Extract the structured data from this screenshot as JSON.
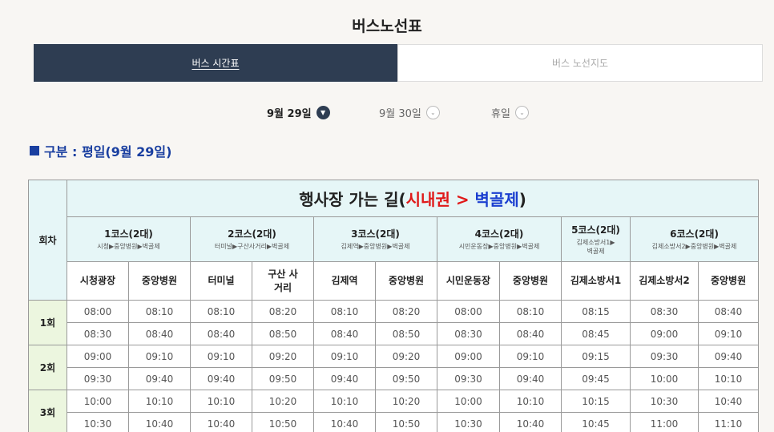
{
  "page": {
    "title": "버스노선표"
  },
  "tabs": [
    {
      "label": "버스 시간표",
      "active": true
    },
    {
      "label": "버스 노선지도",
      "active": false
    }
  ],
  "dates": [
    {
      "label": "9월 29일",
      "selected": true
    },
    {
      "label": "9월 30일",
      "selected": false
    },
    {
      "label": "휴일",
      "selected": false
    }
  ],
  "section": {
    "title": "구분 : 평일(9월 29일)"
  },
  "table": {
    "round_header": "회차",
    "main_title_prefix": "행사장 가는 길(",
    "main_title_from": "시내권",
    "main_title_arrow": " > ",
    "main_title_to": "벽골제",
    "main_title_suffix": ")",
    "courses": [
      {
        "name": "1코스(2대)",
        "route": "시청▶중앙병원▶벽골제",
        "stops": [
          "시청광장",
          "중앙병원"
        ]
      },
      {
        "name": "2코스(2대)",
        "route": "터미널▶구산사거리▶벽골제",
        "stops": [
          "터미널",
          "구산 사거리"
        ]
      },
      {
        "name": "3코스(2대)",
        "route": "김제역▶중앙병원▶벽골제",
        "stops": [
          "김제역",
          "중앙병원"
        ]
      },
      {
        "name": "4코스(2대)",
        "route": "시민운동장▶중앙병원▶벽골제",
        "stops": [
          "시민운동장",
          "중앙병원"
        ]
      },
      {
        "name": "5코스(2대)",
        "route": "김제소방서1▶ 벽골제",
        "stops": [
          "김제소방서1"
        ]
      },
      {
        "name": "6코스(2대)",
        "route": "김제소방서2▶중앙병원▶벽골제",
        "stops": [
          "김제소방서2",
          "중앙병원"
        ]
      }
    ],
    "rounds": [
      {
        "label": "1회",
        "rows": [
          [
            "08:00",
            "08:10",
            "08:10",
            "08:20",
            "08:10",
            "08:20",
            "08:00",
            "08:10",
            "08:15",
            "08:30",
            "08:40"
          ],
          [
            "08:30",
            "08:40",
            "08:40",
            "08:50",
            "08:40",
            "08:50",
            "08:30",
            "08:40",
            "08:45",
            "09:00",
            "09:10"
          ]
        ]
      },
      {
        "label": "2회",
        "rows": [
          [
            "09:00",
            "09:10",
            "09:10",
            "09:20",
            "09:10",
            "09:20",
            "09:00",
            "09:10",
            "09:15",
            "09:30",
            "09:40"
          ],
          [
            "09:30",
            "09:40",
            "09:40",
            "09:50",
            "09:40",
            "09:50",
            "09:30",
            "09:40",
            "09:45",
            "10:00",
            "10:10"
          ]
        ]
      },
      {
        "label": "3회",
        "rows": [
          [
            "10:00",
            "10:10",
            "10:10",
            "10:20",
            "10:10",
            "10:20",
            "10:00",
            "10:10",
            "10:15",
            "10:30",
            "10:40"
          ],
          [
            "10:30",
            "10:40",
            "10:40",
            "10:50",
            "10:40",
            "10:50",
            "10:30",
            "10:40",
            "10:45",
            "11:00",
            "11:10"
          ]
        ]
      }
    ]
  }
}
